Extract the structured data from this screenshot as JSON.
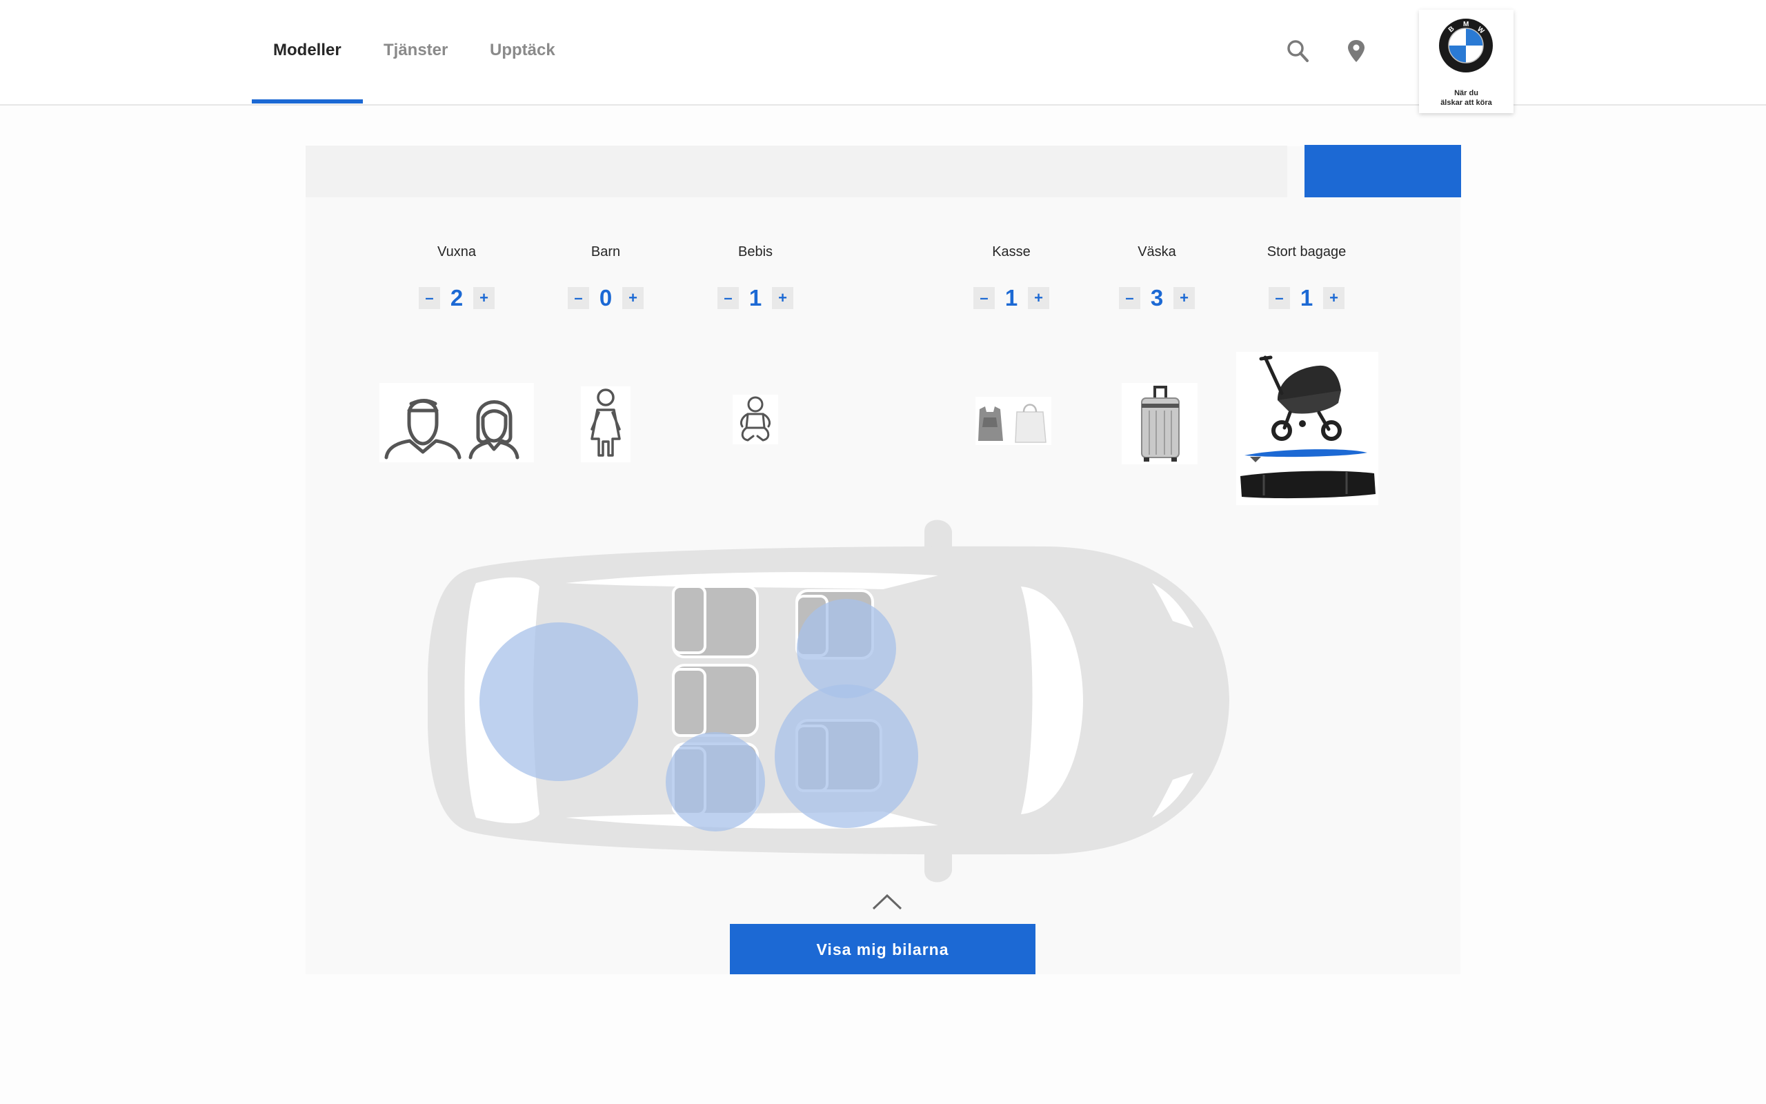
{
  "nav": {
    "items": [
      {
        "label": "Modeller",
        "active": true
      },
      {
        "label": "Tjänster",
        "active": false
      },
      {
        "label": "Upptäck",
        "active": false
      }
    ],
    "search_icon": "search-icon",
    "location_icon": "location-pin-icon"
  },
  "brand": {
    "logo_letters": "BMW",
    "tagline_line1": "När du",
    "tagline_line2": "älskar att köra"
  },
  "search": {
    "placeholder": "",
    "button_label": ""
  },
  "counters": [
    {
      "label": "Vuxna",
      "value": "2",
      "icon": "adults-icon"
    },
    {
      "label": "Barn",
      "value": "0",
      "icon": "child-icon"
    },
    {
      "label": "Bebis",
      "value": "1",
      "icon": "baby-icon"
    },
    {
      "label": "Kasse",
      "value": "1",
      "icon": "shopping-bags-icon"
    },
    {
      "label": "Väska",
      "value": "3",
      "icon": "suitcase-icon"
    },
    {
      "label": "Stort bagage",
      "value": "1",
      "icon": "large-luggage-icon"
    }
  ],
  "stepper_symbols": {
    "minus": "–",
    "plus": "+"
  },
  "colors": {
    "accent": "#1c69d4",
    "panel": "#f9f9f9",
    "car": "#e3e3e3",
    "seat_highlight": "#a8c1ea"
  },
  "cta": {
    "label": "Visa mig bilarna"
  }
}
